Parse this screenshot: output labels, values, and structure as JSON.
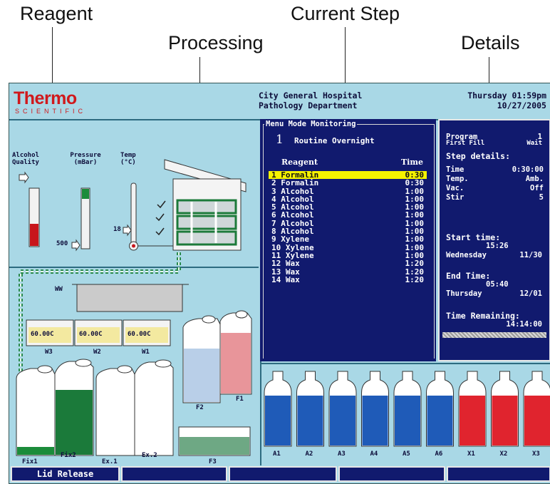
{
  "callouts": {
    "reagent": "Reagent",
    "processing": "Processing",
    "current_step": "Current Step",
    "details": "Details"
  },
  "header": {
    "brand": "Thermo",
    "brand_sub": "SCIENTIFIC",
    "hospital": "City General Hospital",
    "department": "Pathology Department",
    "day_time": "Thursday 01:59pm",
    "date": "10/27/2005"
  },
  "gauges": {
    "alcohol_quality": "Alcohol Quality",
    "pressure": "Pressure (mBar)",
    "temp": "Temp (°C)",
    "pressure_value": "500",
    "temp_value": "18"
  },
  "baths": {
    "wax_label": "WW",
    "w3": "W3",
    "w2": "W2",
    "w1": "W1",
    "temp3": "60.00C",
    "temp2": "60.00C",
    "temp1": "60.00C"
  },
  "containers": {
    "fix1": "Fix1",
    "fix2": "Fix2",
    "ex1": "Ex.1",
    "ex2": "Ex.2",
    "f2": "F2",
    "f1": "F1",
    "f3": "F3"
  },
  "monitor": {
    "title": "Menu Mode Monitoring",
    "program_no": "1",
    "program_name": "Routine Overnight",
    "col_reagent": "Reagent",
    "col_time": "Time",
    "active_index": 0,
    "steps": [
      {
        "name": "1 Formalin",
        "time": "0:30"
      },
      {
        "name": "2 Formalin",
        "time": "0:30"
      },
      {
        "name": "3 Alcohol",
        "time": "1:00"
      },
      {
        "name": "4 Alcohol",
        "time": "1:00"
      },
      {
        "name": "5 Alcohol",
        "time": "1:00"
      },
      {
        "name": "6 Alcohol",
        "time": "1:00"
      },
      {
        "name": "7 Alcohol",
        "time": "1:00"
      },
      {
        "name": "8 Alcohol",
        "time": "1:00"
      },
      {
        "name": "9 Xylene",
        "time": "1:00"
      },
      {
        "name": "10 Xylene",
        "time": "1:00"
      },
      {
        "name": "11 Xylene",
        "time": "1:00"
      },
      {
        "name": "12 Wax",
        "time": "1:20"
      },
      {
        "name": "13 Wax",
        "time": "1:20"
      },
      {
        "name": "14 Wax",
        "time": "1:20"
      }
    ]
  },
  "details": {
    "program_label": "Program",
    "program_value": "1",
    "first_fill": "First Fill",
    "wait": "Wait",
    "step_details": "Step details:",
    "rows": [
      {
        "k": "Time",
        "v": "0:30:00"
      },
      {
        "k": "Temp.",
        "v": "Amb."
      },
      {
        "k": "Vac.",
        "v": "Off"
      },
      {
        "k": "Stir",
        "v": "5"
      }
    ],
    "start_label": "Start time:",
    "start_time": "15:26",
    "start_day": "Wednesday",
    "start_date": "11/30",
    "end_label": "End Time:",
    "end_time": "05:40",
    "end_day": "Thursday",
    "end_date": "12/01",
    "remaining_label": "Time Remaining:",
    "remaining": "14:14:00"
  },
  "bottles": [
    {
      "label": "A1",
      "color": "#1f5bb8"
    },
    {
      "label": "A2",
      "color": "#1f5bb8"
    },
    {
      "label": "A3",
      "color": "#1f5bb8"
    },
    {
      "label": "A4",
      "color": "#1f5bb8"
    },
    {
      "label": "A5",
      "color": "#1f5bb8"
    },
    {
      "label": "A6",
      "color": "#1f5bb8"
    },
    {
      "label": "X1",
      "color": "#e0242e"
    },
    {
      "label": "X2",
      "color": "#e0242e"
    },
    {
      "label": "X3",
      "color": "#e0242e"
    }
  ],
  "softkeys": [
    "Lid Release",
    "",
    "",
    "",
    ""
  ]
}
